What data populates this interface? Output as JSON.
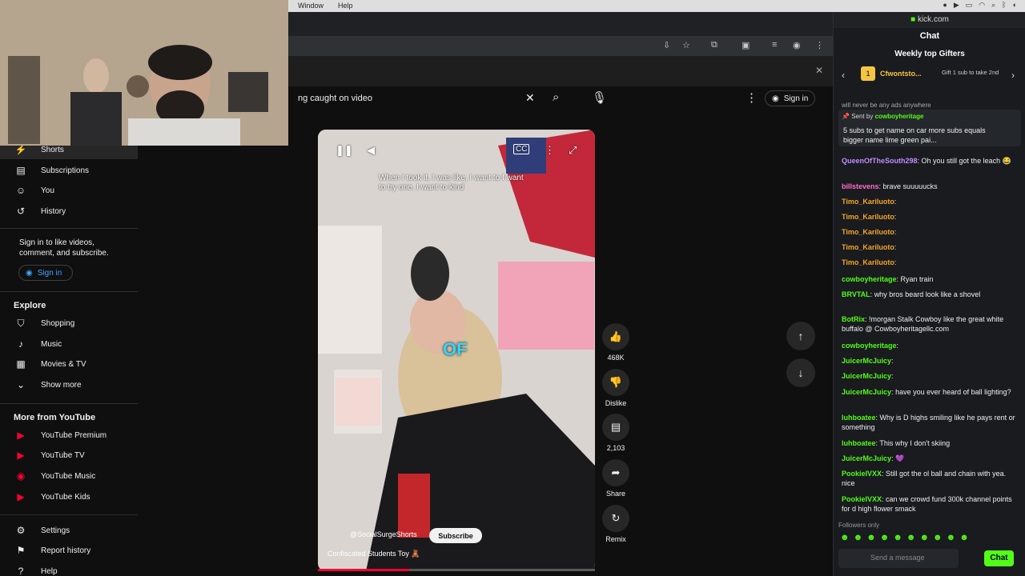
{
  "menubar": {
    "window": "Window",
    "help": "Help"
  },
  "yt": {
    "search_query": "ng caught on video",
    "sign_in": "Sign in",
    "sidebar": {
      "shorts": "Shorts",
      "subscriptions": "Subscriptions",
      "you": "You",
      "history": "History",
      "signin_note": "Sign in to like videos, comment, and subscribe.",
      "signin_button": "Sign in",
      "explore_heading": "Explore",
      "shopping": "Shopping",
      "music": "Music",
      "movies_tv": "Movies & TV",
      "show_more": "Show more",
      "more_heading": "More from YouTube",
      "premium": "YouTube Premium",
      "tv": "YouTube TV",
      "yt_music": "YouTube Music",
      "kids": "YouTube Kids",
      "settings": "Settings",
      "report_history": "Report history",
      "help": "Help"
    },
    "short": {
      "caption": "When I took it, I was like, I want to I want to try one. I want to kind",
      "overlay_word": "OF",
      "channel": "@SocialSurgeShorts",
      "subscribe": "Subscribe",
      "title": "Confiscated Students Toy 🧸",
      "progress": 0.33
    },
    "actions": {
      "likes": "468K",
      "dislike": "Dislike",
      "comments": "2,103",
      "share": "Share",
      "remix": "Remix"
    }
  },
  "kick": {
    "url": "kick.com",
    "chat_title": "Chat",
    "gifters_title": "Weekly top Gifters",
    "top_gifter": "Cfwontsto...",
    "gift_note": "Gift 1 sub to take 2nd",
    "pinned_partial": "will never be any ads anywhere",
    "pinned_sent_by": "Sent by",
    "pinned_user": "cowboyheritage",
    "pinned_message": "5 subs to get name on car more subs equals bigger name lime green pai...",
    "messages": [
      {
        "user": "QueenOfTheSouth298",
        "text": "Oh you still got the leach 😂",
        "color": "#c08cff"
      },
      {
        "user": "billstevens",
        "text": "brave suuuuucks",
        "color": "#ff6ec7"
      },
      {
        "user": "Timo_Kariluoto",
        "text": "",
        "color": "#f5a623"
      },
      {
        "user": "Timo_Kariluoto",
        "text": "",
        "color": "#f5a623"
      },
      {
        "user": "Timo_Kariluoto",
        "text": "",
        "color": "#f5a623"
      },
      {
        "user": "Timo_Kariluoto",
        "text": "",
        "color": "#f5a623"
      },
      {
        "user": "Timo_Kariluoto",
        "text": "",
        "color": "#f5a623"
      },
      {
        "user": "cowboyheritage",
        "text": "Ryan train",
        "color": "#53fc18"
      },
      {
        "user": "BRVTAL",
        "text": "why bros beard look like a shovel",
        "color": "#53fc18"
      },
      {
        "user": "BotRix",
        "text": "!morgan Stalk Cowboy like the great white buffalo @ Cowboyheritagellc.com",
        "color": "#53fc18"
      },
      {
        "user": "cowboyheritage",
        "text": "",
        "color": "#53fc18"
      },
      {
        "user": "JuicerMcJuicy",
        "text": "",
        "color": "#53fc18"
      },
      {
        "user": "JuicerMcJuicy",
        "text": "",
        "color": "#53fc18"
      },
      {
        "user": "JuicerMcJuicy",
        "text": "have you ever heard of ball lighting?",
        "color": "#53fc18"
      },
      {
        "user": "luhboatee",
        "text": "Why is D highs smiling like he pays rent or something",
        "color": "#53fc18"
      },
      {
        "user": "luhboatee",
        "text": "This why I don't skiing",
        "color": "#53fc18"
      },
      {
        "user": "JuicerMcJuicy",
        "text": "💜",
        "color": "#53fc18"
      },
      {
        "user": "PookieIVXX",
        "text": "Still got the ol ball and chain with yea. nice",
        "color": "#53fc18"
      },
      {
        "user": "PookieIVXX",
        "text": "can we crowd fund 300k channel points for d high flower smack",
        "color": "#53fc18"
      }
    ],
    "followers_only": "Followers only",
    "input_placeholder": "Send a message",
    "chat_button": "Chat"
  }
}
